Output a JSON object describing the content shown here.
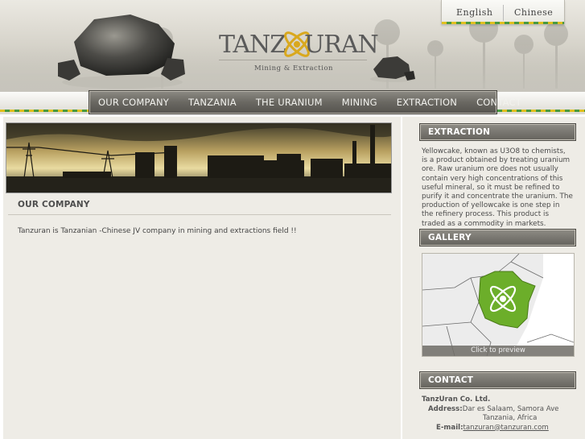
{
  "header": {
    "logo_part1": "TANZ",
    "logo_part2": "URAN",
    "tagline": "Mining & Extraction"
  },
  "languages": [
    "English",
    "Chinese"
  ],
  "nav": [
    "OUR COMPANY",
    "TANZANIA",
    "THE URANIUM",
    "MINING",
    "EXTRACTION",
    "CONTACT"
  ],
  "main": {
    "section_title": "OUR COMPANY",
    "text": "Tanzuran is Tanzanian -Chinese JV company in mining and extractions field !!"
  },
  "sidebar": {
    "extraction_title": "EXTRACTION",
    "extraction_text": "Yellowcake, known as U3O8 to chemists, is a product obtained by treating uranium ore. Raw uranium ore does not usually contain very high concentrations of this useful mineral, so it must be refined to purify it and concentrate the uranium. The production of yellowcake is one step in the refinery process. This product is traded as a commodity in markets.",
    "gallery_title": "GALLERY",
    "gallery_caption": "Click to preview",
    "contact_title": "CONTACT",
    "contact_company": "TanzUran Co. Ltd.",
    "address_label": "Address:",
    "address_line1": "Dar es Salaam, Samora Ave",
    "address_line2": "Tanzania, Africa",
    "email_label": "E-mail:",
    "email": "tanzuran@tanzuran.com"
  },
  "colors": {
    "accent_yellow": "#e0c020",
    "accent_green": "#4a9a40",
    "map_green": "#6cae2a",
    "nav_dark": "#5f5d57"
  }
}
